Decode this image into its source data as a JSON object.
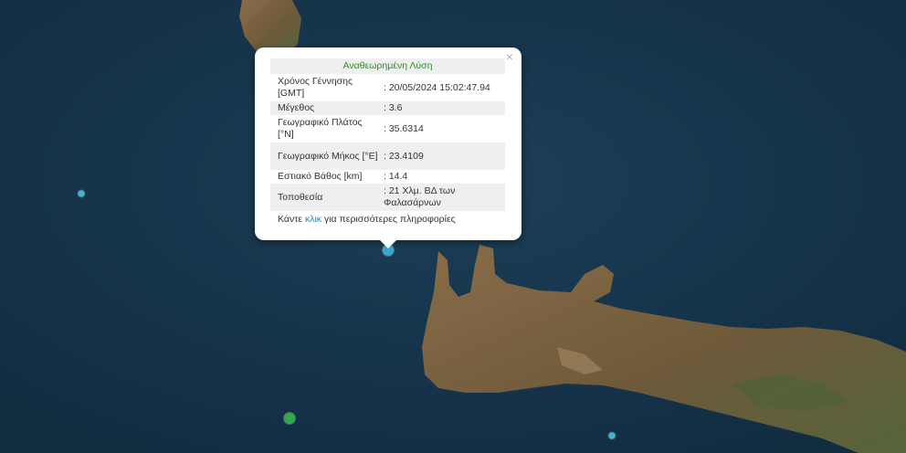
{
  "popup": {
    "title": "Αναθεωρημένη Λύση",
    "rows": [
      {
        "label": "Χρόνος Γέννησης [GMT]",
        "value": ": 20/05/2024 15:02:47.94"
      },
      {
        "label": "Μέγεθος",
        "value": ": 3.6"
      },
      {
        "label": "Γεωγραφικό Πλάτος [°N]",
        "value": ": 35.6314"
      },
      {
        "label": "Γεωγραφικό Μήκος [°E]",
        "value": ": 23.4109"
      },
      {
        "label": "Εστιακό Βάθος [km]",
        "value": ": 14.4"
      },
      {
        "label": "Τοποθεσία",
        "value": ": 21 Χλμ. ΒΔ των Φαλασάρνων"
      }
    ],
    "more_prefix": "Κάντε ",
    "more_link": "κλικ",
    "more_suffix": " για περισσότερες πληροφορίες",
    "close_symbol": "×"
  },
  "markers": [
    {
      "name": "selected-quake",
      "color": "#3aa6d1"
    },
    {
      "name": "quake-west",
      "color": "#3fb6d6"
    },
    {
      "name": "quake-southwest",
      "color": "#2fa84a"
    },
    {
      "name": "quake-south",
      "color": "#3fb6d6"
    }
  ],
  "colors": {
    "sea": "#16344a",
    "land": "#7a6142",
    "popup_title": "#2e8b2e",
    "link": "#1a8fc0"
  }
}
